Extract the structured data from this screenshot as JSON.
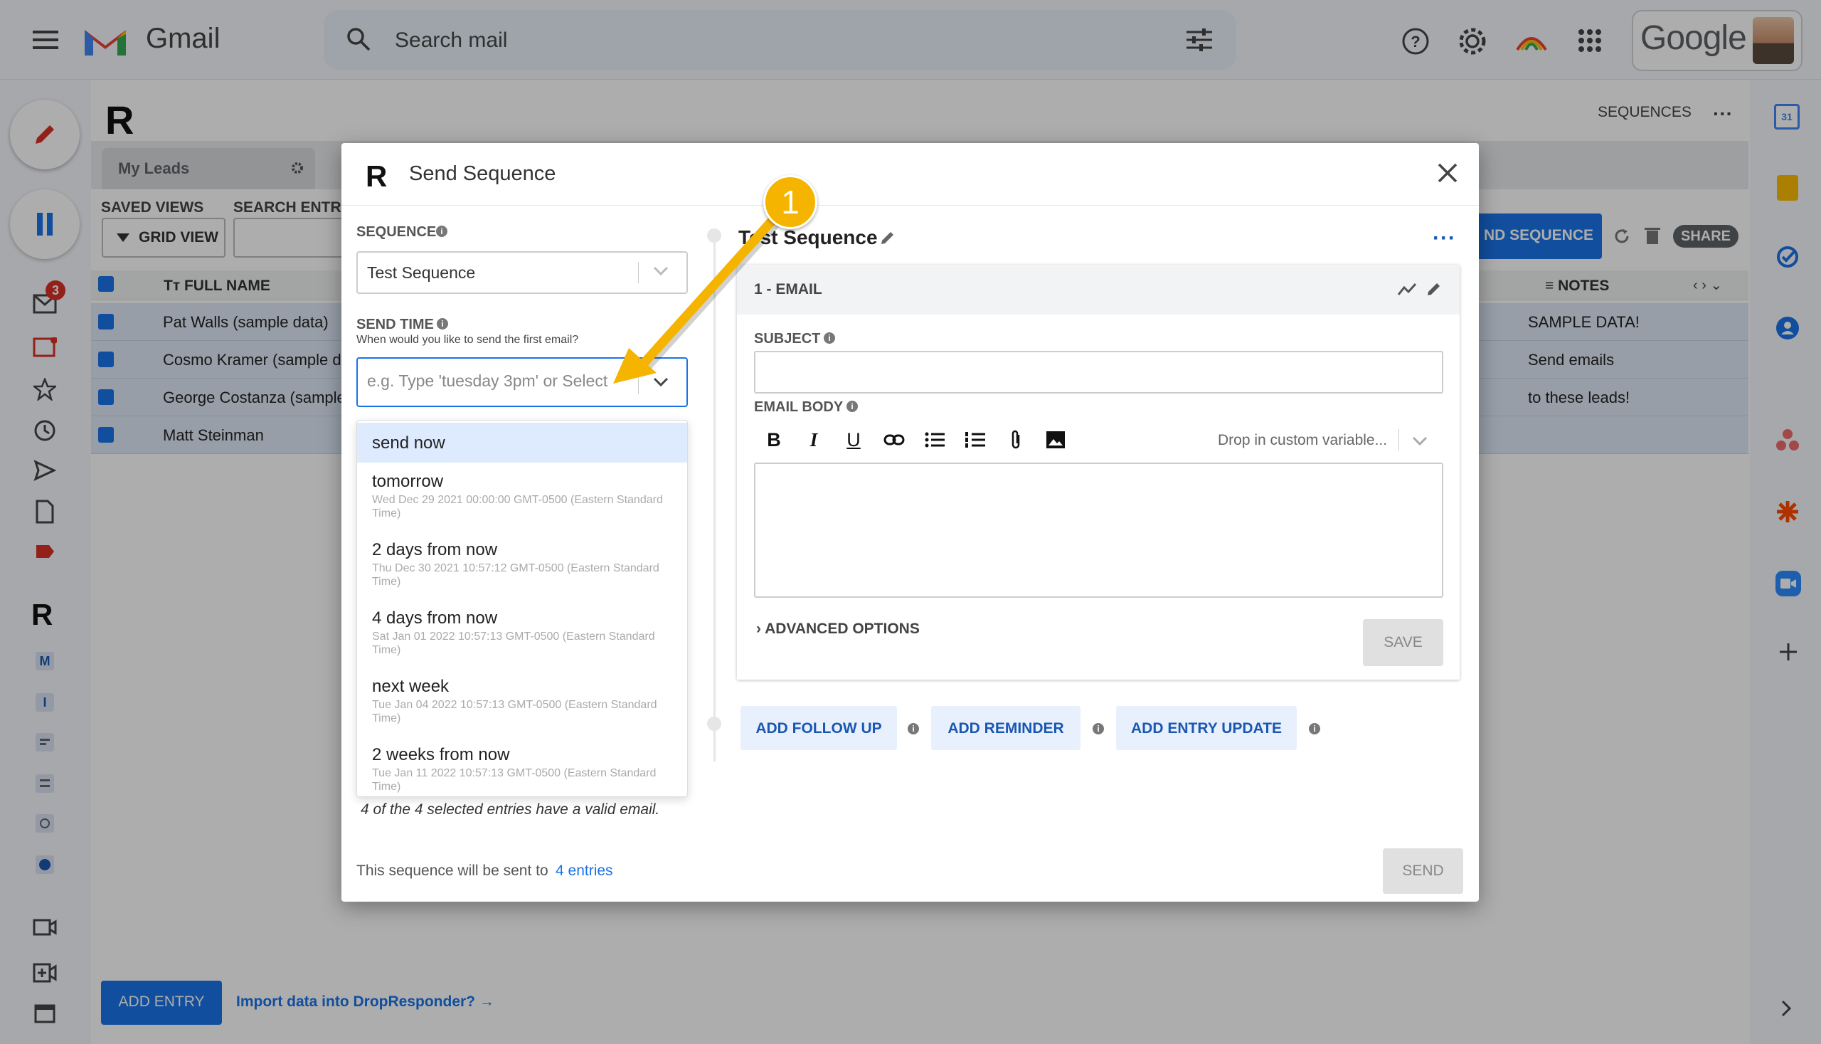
{
  "gmail": {
    "app_name": "Gmail",
    "search_placeholder": "Search mail",
    "account_brand": "Google",
    "badge_count": "3"
  },
  "bg": {
    "sequences_link": "SEQUENCES",
    "tab_my_leads": "My Leads",
    "saved_views_label": "SAVED VIEWS",
    "search_entries_label": "SEARCH ENTRI",
    "grid_view_label": "GRID VIEW",
    "col_full_name": "FULL NAME",
    "col_notes": "NOTES",
    "send_sequence_btn": "ND SEQUENCE",
    "share_btn": "SHARE",
    "rows": [
      {
        "name": "Pat Walls (sample data)",
        "note": "SAMPLE DATA!"
      },
      {
        "name": "Cosmo Kramer (sample da",
        "note": "Send emails"
      },
      {
        "name": "George Costanza (sample",
        "note": "to these leads!"
      },
      {
        "name": "Matt Steinman",
        "note": ""
      }
    ],
    "add_entry_btn": "ADD ENTRY",
    "import_link": "Import data into DropResponder? →"
  },
  "modal": {
    "title": "Send Sequence",
    "sequence_label": "SEQUENCE",
    "sequence_value": "Test Sequence",
    "send_time_label": "SEND TIME",
    "send_time_hint": "When would you like to send the first email?",
    "send_time_placeholder": "e.g. Type 'tuesday 3pm' or Select",
    "options": [
      {
        "label": "send now",
        "sub": ""
      },
      {
        "label": "tomorrow",
        "sub": "Wed Dec 29 2021 00:00:00 GMT-0500 (Eastern Standard Time)"
      },
      {
        "label": "2 days from now",
        "sub": "Thu Dec 30 2021 10:57:12 GMT-0500 (Eastern Standard Time)"
      },
      {
        "label": "4 days from now",
        "sub": "Sat Jan 01 2022 10:57:13 GMT-0500 (Eastern Standard Time)"
      },
      {
        "label": "next week",
        "sub": "Tue Jan 04 2022 10:57:13 GMT-0500 (Eastern Standard Time)"
      },
      {
        "label": "2 weeks from now",
        "sub": "Tue Jan 11 2022 10:57:13 GMT-0500 (Eastern Standard Time)"
      }
    ],
    "valid_msg": "4 of the 4 selected entries have a valid email.",
    "sent_to_prefix": "This sequence will be sent to",
    "sent_to_link": "4 entries",
    "send_btn": "SEND",
    "seq_name": "Test Sequence",
    "card_header": "1 - EMAIL",
    "subject_label": "SUBJECT",
    "email_body_label": "EMAIL BODY",
    "custom_variable": "Drop in custom variable...",
    "advanced_options": "ADVANCED OPTIONS",
    "save_btn": "SAVE",
    "add_follow_up": "ADD FOLLOW UP",
    "add_reminder": "ADD REMINDER",
    "add_entry_update": "ADD ENTRY UPDATE"
  },
  "annotation": {
    "step": "1"
  },
  "colors": {
    "accent": "#1a73e8",
    "highlight": "#f4b400",
    "selected_row": "#dfe9f8"
  }
}
